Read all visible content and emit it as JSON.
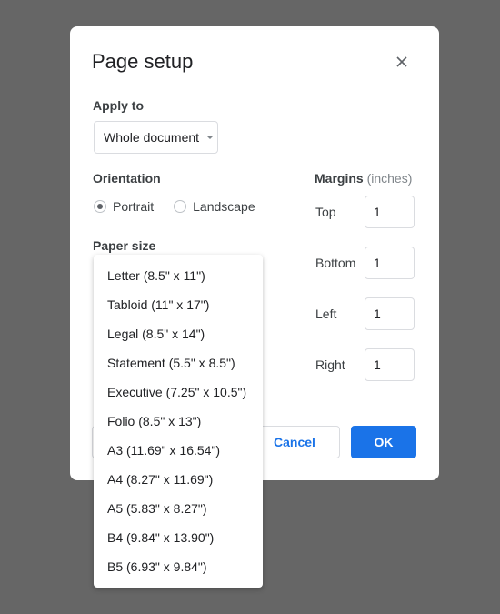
{
  "dialog": {
    "title": "Page setup",
    "close_icon": "close-icon",
    "apply_to": {
      "label": "Apply to",
      "selected": "Whole document"
    },
    "orientation": {
      "label": "Orientation",
      "options": [
        {
          "label": "Portrait",
          "selected": true
        },
        {
          "label": "Landscape",
          "selected": false
        }
      ]
    },
    "paper_size": {
      "label": "Paper size"
    },
    "margins": {
      "label": "Margins",
      "unit": "(inches)",
      "fields": [
        {
          "label": "Top",
          "value": "1"
        },
        {
          "label": "Bottom",
          "value": "1"
        },
        {
          "label": "Left",
          "value": "1"
        },
        {
          "label": "Right",
          "value": "1"
        }
      ]
    },
    "buttons": {
      "cancel": "Cancel",
      "ok": "OK"
    }
  },
  "paper_size_menu": {
    "options": [
      "Letter (8.5\" x 11\")",
      "Tabloid (11\" x 17\")",
      "Legal (8.5\" x 14\")",
      "Statement (5.5\" x 8.5\")",
      "Executive (7.25\" x 10.5\")",
      "Folio (8.5\" x 13\")",
      "A3 (11.69\" x 16.54\")",
      "A4 (8.27\" x 11.69\")",
      "A5 (5.83\" x 8.27\")",
      "B4 (9.84\" x 13.90\")",
      "B5 (6.93\" x 9.84\")"
    ]
  },
  "colors": {
    "backdrop": "#666666",
    "primary": "#1a73e8"
  }
}
